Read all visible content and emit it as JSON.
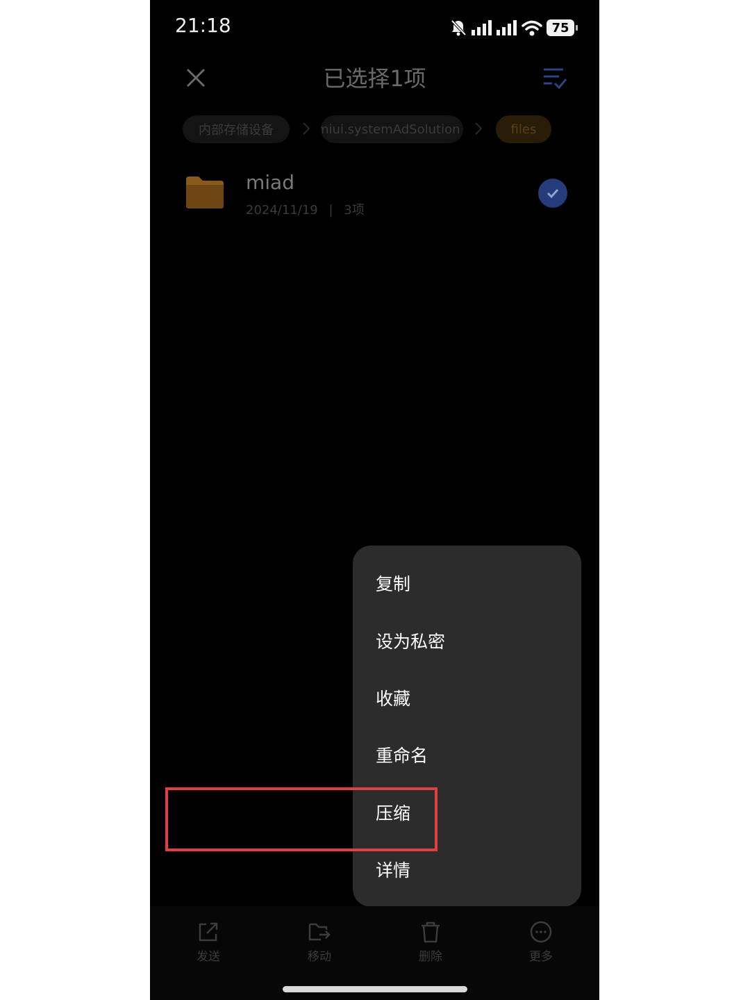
{
  "status_bar": {
    "time": "21:18",
    "battery": "75",
    "icons": [
      "mute-bell-icon",
      "signal-icon",
      "signal-icon",
      "wifi-icon",
      "battery-icon"
    ]
  },
  "header": {
    "title": "已选择1项",
    "close_icon": "close-icon",
    "select_all_icon": "select-all-icon"
  },
  "breadcrumbs": [
    {
      "label": "内部存储设备"
    },
    {
      "label": "miui.systemAdSolution"
    },
    {
      "label": "files"
    }
  ],
  "file": {
    "name": "miad",
    "date": "2024/11/19",
    "count": "3项",
    "selected": true
  },
  "menu": {
    "items": [
      {
        "label": "复制"
      },
      {
        "label": "设为私密"
      },
      {
        "label": "收藏"
      },
      {
        "label": "重命名"
      },
      {
        "label": "压缩"
      },
      {
        "label": "详情"
      }
    ],
    "highlighted": "压缩"
  },
  "toolbar": {
    "items": [
      {
        "label": "发送",
        "icon": "share-icon"
      },
      {
        "label": "移动",
        "icon": "move-folder-icon"
      },
      {
        "label": "删除",
        "icon": "trash-icon"
      },
      {
        "label": "更多",
        "icon": "more-icon"
      }
    ]
  },
  "colors": {
    "highlight_border": "#e0403f",
    "menu_background": "#2c2c2c",
    "check_accent": "#243c7a",
    "folder": "#8a5a1c"
  }
}
